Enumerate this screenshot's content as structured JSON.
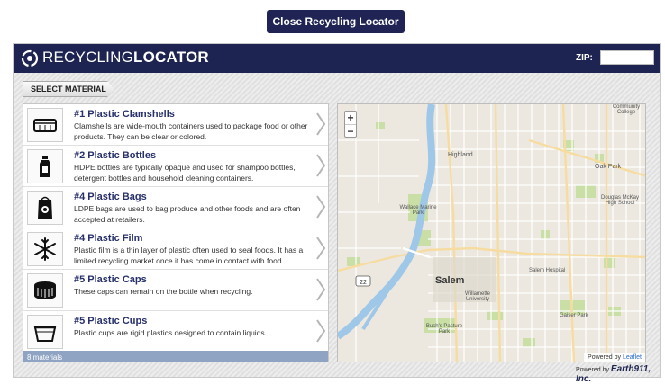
{
  "close_button": {
    "label": "Close Recycling Locator"
  },
  "header": {
    "brand_part1": "RECYCLING",
    "brand_part2": "LOCATOR",
    "zip_label": "ZIP:",
    "zip_value": ""
  },
  "tab": {
    "label": "SELECT MATERIAL"
  },
  "materials": {
    "items": [
      {
        "title": "#1 Plastic Clamshells",
        "description": "Clamshells are wide-mouth containers used to package food or other products. They can be clear or colored.",
        "icon": "clamshell-icon"
      },
      {
        "title": "#2 Plastic Bottles",
        "description": "HDPE bottles are typically opaque and used for shampoo bottles, detergent bottles and household cleaning containers.",
        "icon": "bottle-icon"
      },
      {
        "title": "#4 Plastic Bags",
        "description": "LDPE bags are used to bag produce and other foods and are often accepted at retailers.",
        "icon": "bag-icon"
      },
      {
        "title": "#4 Plastic Film",
        "description": "Plastic film is a thin layer of plastic often used to seal foods. It has a limited recycling market once it has come in contact with food.",
        "icon": "snowflake-icon"
      },
      {
        "title": "#5 Plastic Caps",
        "description": "These caps can remain on the bottle when recycling.",
        "icon": "cap-icon"
      },
      {
        "title": "#5 Plastic Cups",
        "description": "Plastic cups are rigid plastics designed to contain liquids.",
        "icon": "cup-icon"
      }
    ],
    "count_label": "8 materials"
  },
  "map": {
    "zoom_in": "+",
    "zoom_out": "−",
    "attribution_prefix": "Powered by",
    "attribution_link": "Leaflet",
    "labels": {
      "salem": "Salem",
      "highland": "Highland",
      "oak_park": "Oak Park",
      "wallace_marine_park": "Wallace Marine Park",
      "douglas_mckay": "Douglas McKay High School",
      "salem_hospital": "Salem Hospital",
      "willamette": "Willamette University",
      "bush_pasture": "Bush's Pasture Park",
      "gaiser_park": "Gaiser Park",
      "community_college": "Community College",
      "route_22": "22"
    }
  },
  "footer": {
    "powered_prefix": "Powered by",
    "powered_brand": "Earth911, Inc."
  }
}
